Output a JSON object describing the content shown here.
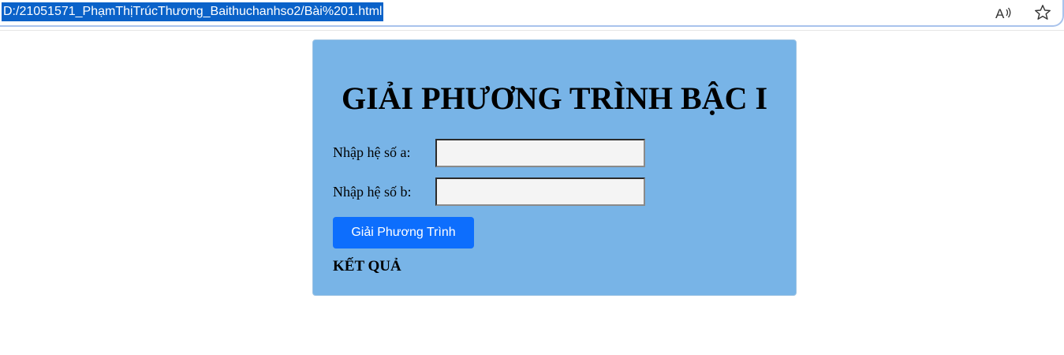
{
  "browser": {
    "url": "D:/21051571_PhạmThịTrúcThương_Baithuchanhso2/Bài%201.html",
    "icons": [
      "read-aloud-icon",
      "favorite-star-icon"
    ]
  },
  "page": {
    "title": "GIẢI PHƯƠNG TRÌNH BẬC I",
    "label_a": "Nhập hệ số a:",
    "label_b": "Nhập hệ số b:",
    "input_a_value": "",
    "input_b_value": "",
    "solve_button": "Giải Phương Trình",
    "result_heading": "KẾT QUẢ",
    "colors": {
      "card_background": "#78b4e7",
      "button_background": "#0d6efd",
      "input_background": "#f4f4f4"
    }
  }
}
